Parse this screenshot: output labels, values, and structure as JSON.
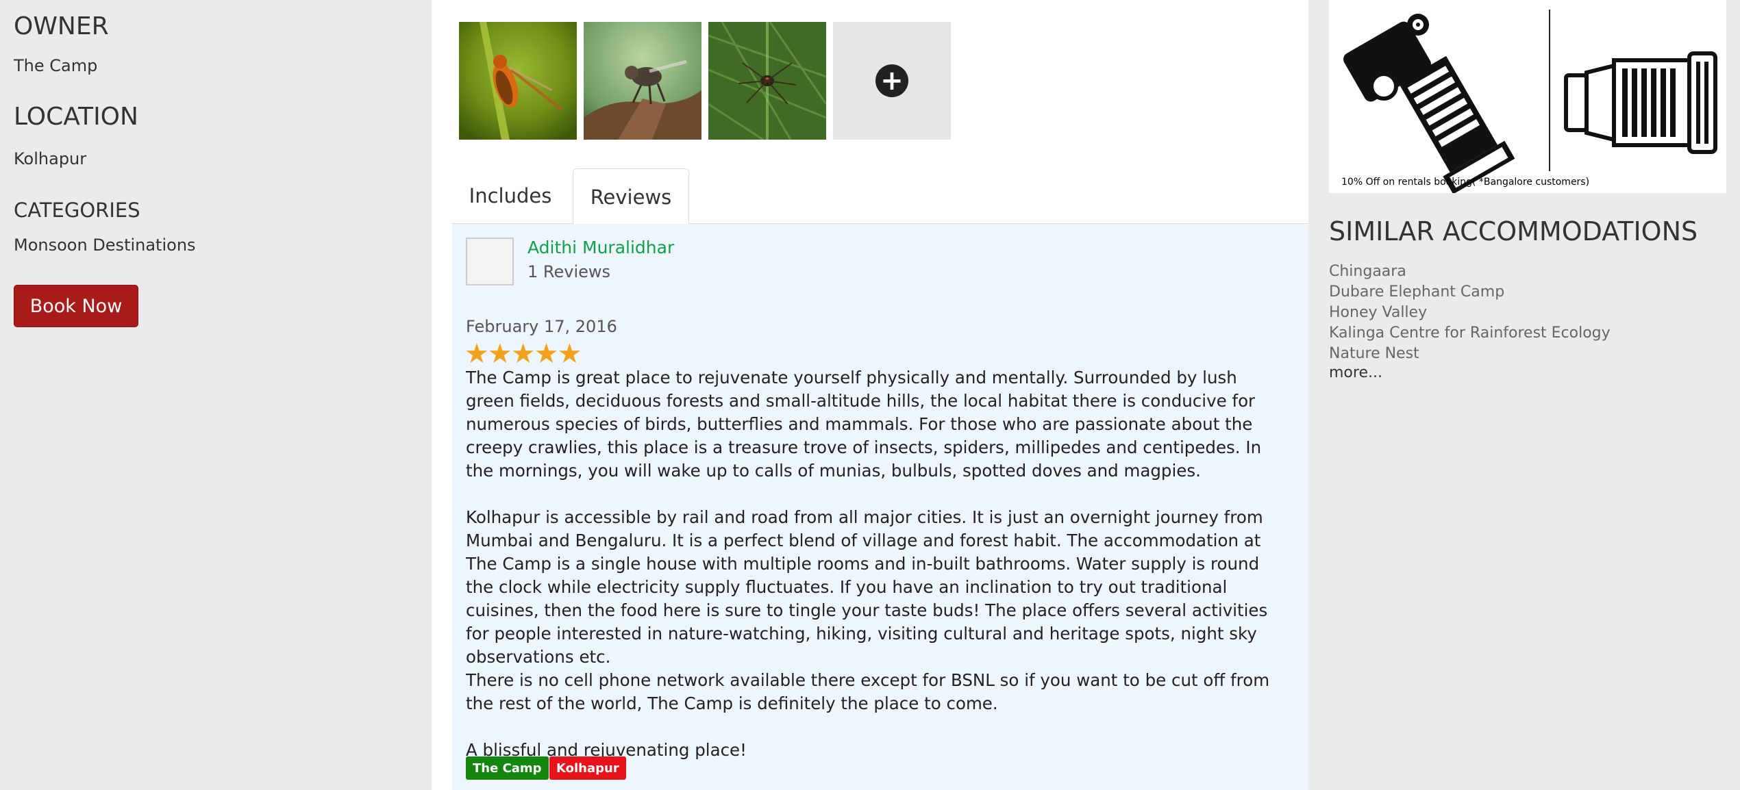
{
  "sidebar": {
    "owner_heading": "OWNER",
    "owner_value": "The Camp",
    "location_heading": "LOCATION",
    "location_value": "Kolhapur",
    "categories_heading": "CATEGORIES",
    "categories_value": "Monsoon Destinations",
    "book_label": "Book Now"
  },
  "gallery": {
    "photos": [
      {
        "subject": "orange insect on grass stem"
      },
      {
        "subject": "robber fly on bark"
      },
      {
        "subject": "spider on green leaf"
      }
    ],
    "add_icon": "plus-circle-icon"
  },
  "tabs": [
    {
      "label": "Includes",
      "active": false
    },
    {
      "label": "Reviews",
      "active": true
    }
  ],
  "review": {
    "reviewer_name": "Adithi Muralidhar",
    "reviewer_count": "1 Reviews",
    "date": "February 17, 2016",
    "stars": "★★★★★",
    "rating": 5,
    "paragraphs": [
      "The Camp is great place to rejuvenate yourself physically and mentally. Surrounded by lush green fields, deciduous forests and small-altitude hills, the local habitat there is conducive for numerous species of birds, butterflies and mammals. For those who are passionate about the creepy crawlies, this place is a treasure trove of insects, spiders, millipedes and centipedes. In the mornings, you will wake up to calls of munias, bulbuls, spotted doves and magpies.",
      "Kolhapur is accessible by rail and road from all major cities. It is just an overnight journey from Mumbai and Bengaluru. It is a perfect blend of village and forest habit. The accommodation at The Camp is a single house with multiple rooms and in-built bathrooms. Water supply is round the clock while electricity supply fluctuates. If you have an inclination to try out traditional cuisines, then the food here is sure to tingle your taste buds! The place offers several activities for people interested in nature-watching, hiking, visiting cultural and heritage spots, night sky observations etc.",
      "There is no cell phone network available there except for BSNL so if you want to be cut off from the rest of the world, The Camp is definitely the place to come.",
      "A blissful and rejuvenating place!"
    ],
    "tags": [
      {
        "label": "The Camp",
        "color": "#14860f"
      },
      {
        "label": "Kolhapur",
        "color": "#e8131a"
      }
    ]
  },
  "ad": {
    "caption": "10% Off on rentals booking( *Bangalore customers)"
  },
  "similar": {
    "heading": "SIMILAR ACCOMMODATIONS",
    "items": [
      "Chingaara",
      "Dubare Elephant Camp",
      "Honey Valley",
      "Kalinga Centre for Rainforest Ecology",
      "Nature Nest"
    ],
    "more_label": "more..."
  },
  "colors": {
    "page_bg": "#ebebeb",
    "book_button": "#a91a1a",
    "reviewer_link": "#10a04c",
    "star": "#f0a31a",
    "review_panel_bg": "#eef5fc"
  }
}
